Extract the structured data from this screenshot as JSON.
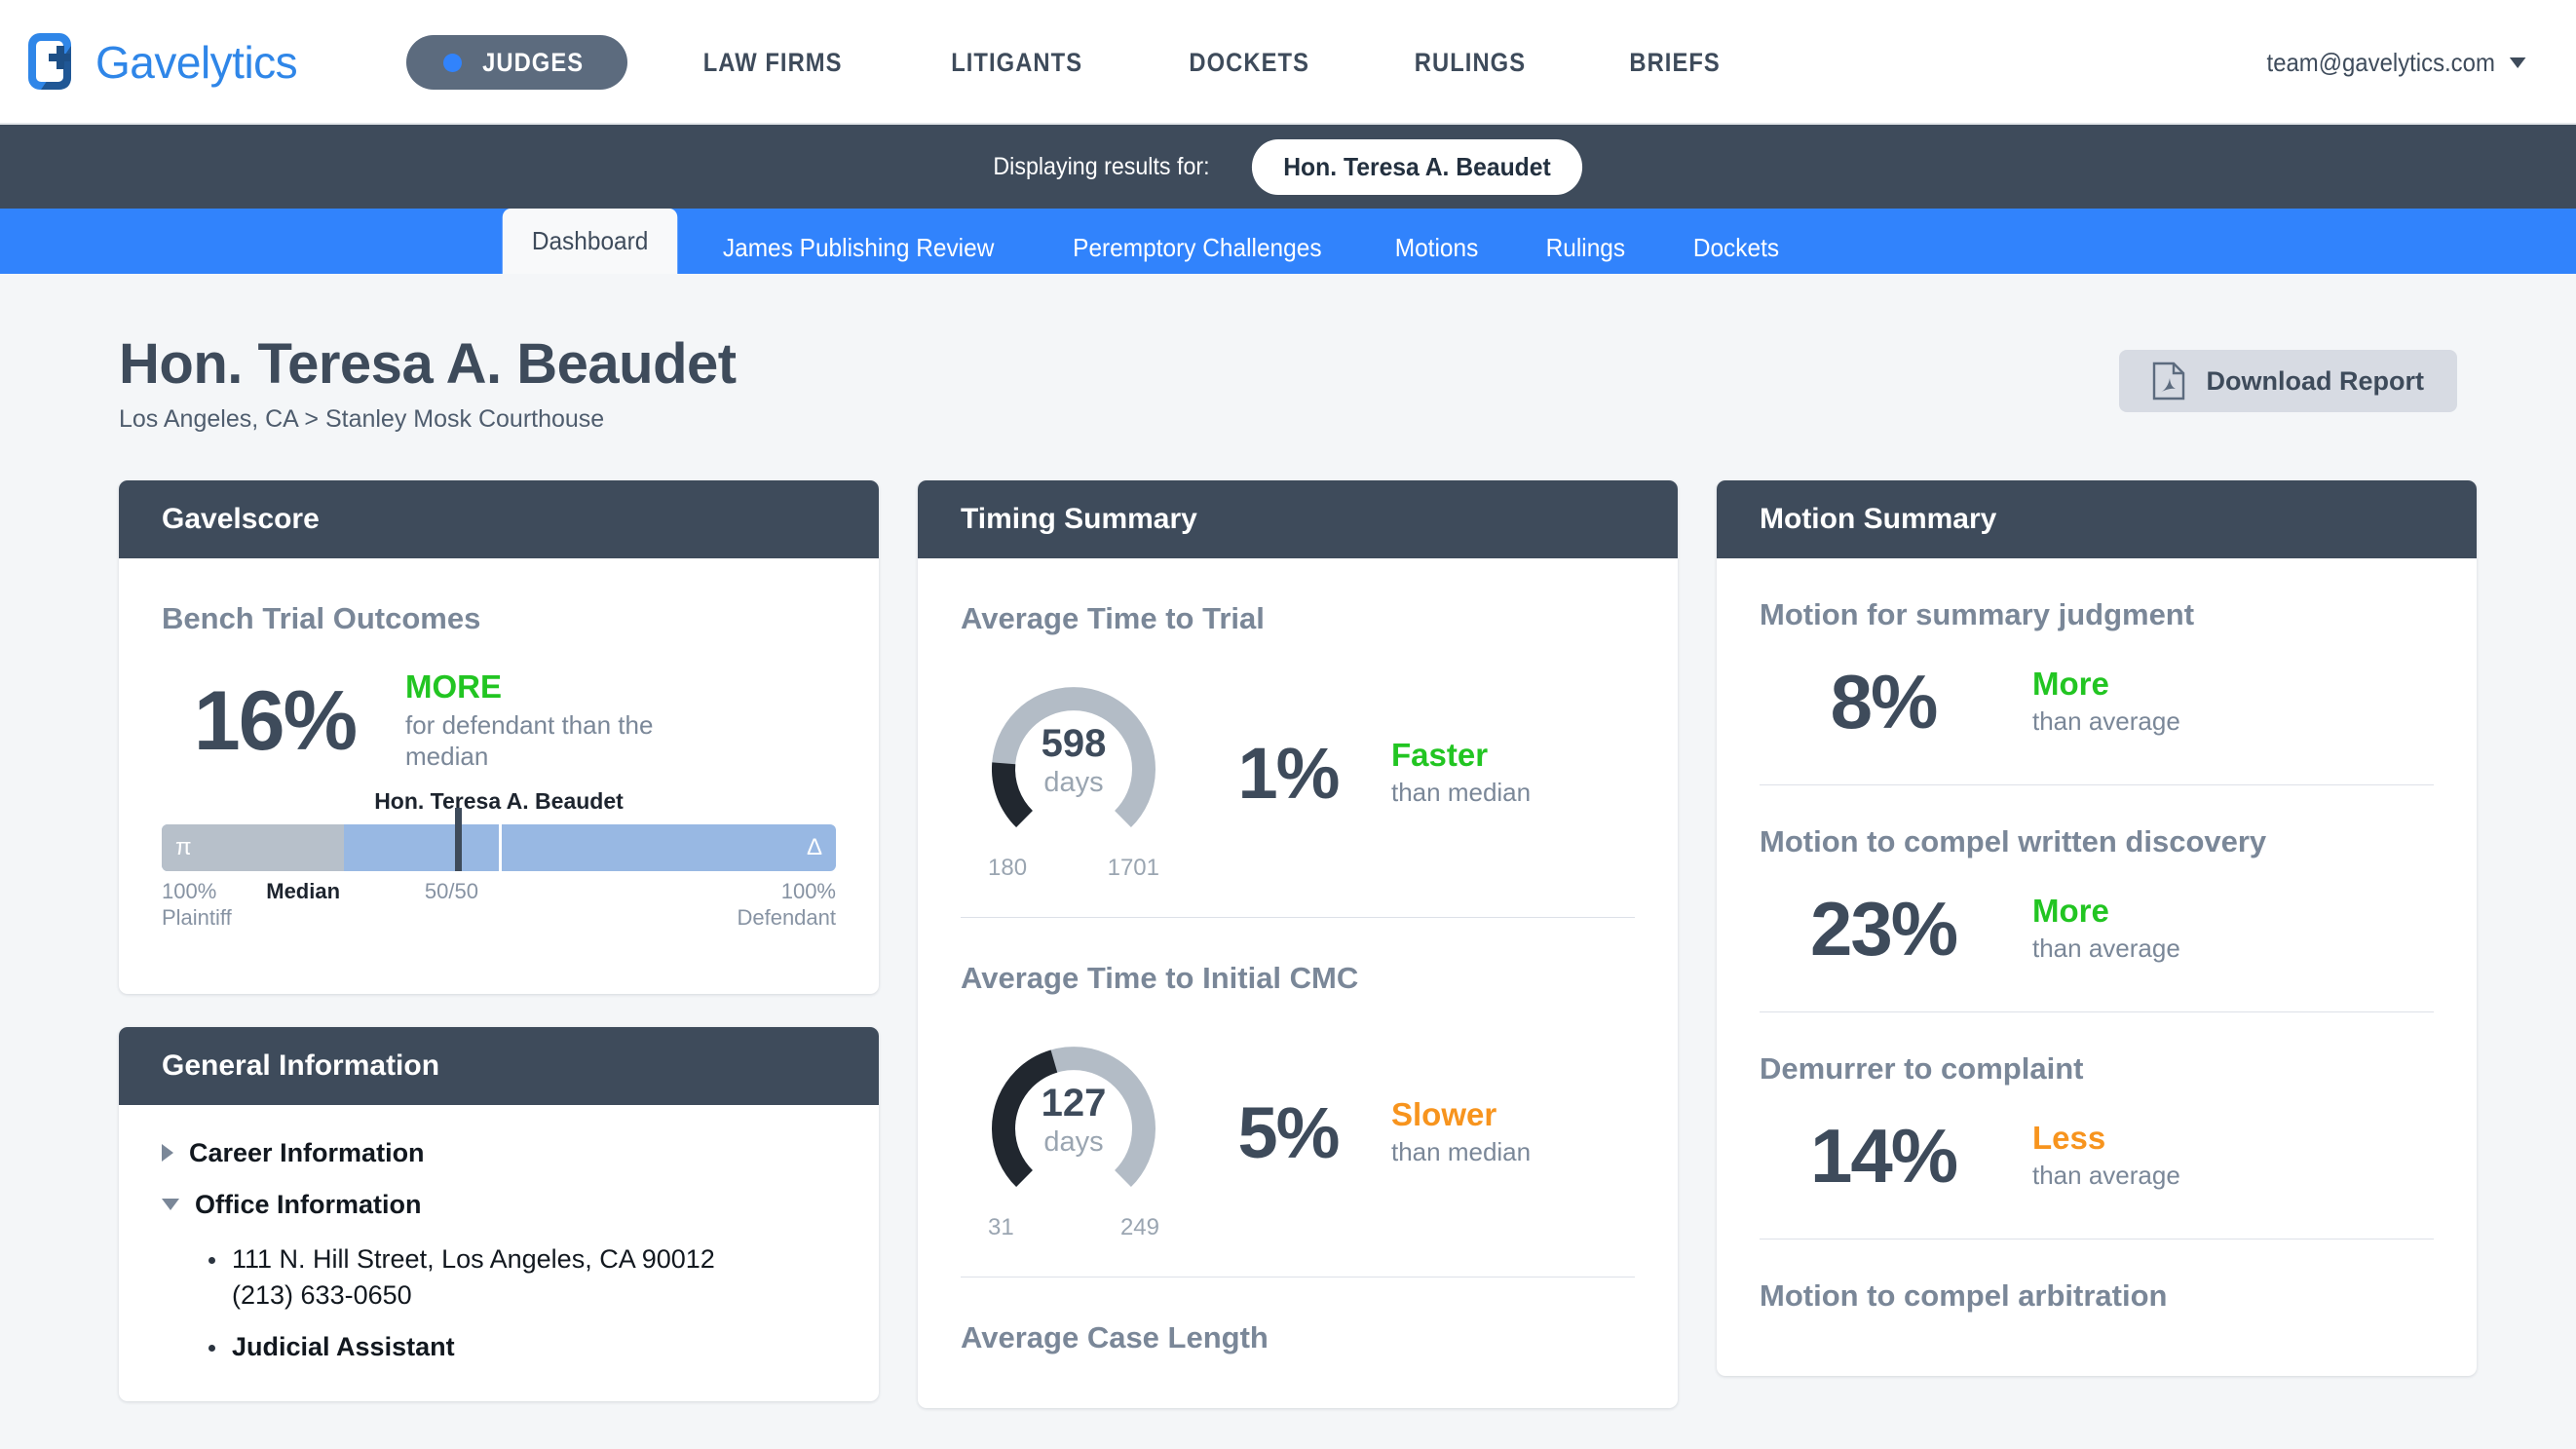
{
  "brand": {
    "name": "Gavelytics",
    "logo_icon": "gavelytics-logo-icon"
  },
  "topnav": {
    "items": [
      {
        "label": "JUDGES",
        "active": true
      },
      {
        "label": "LAW FIRMS",
        "active": false
      },
      {
        "label": "LITIGANTS",
        "active": false
      },
      {
        "label": "DOCKETS",
        "active": false
      },
      {
        "label": "RULINGS",
        "active": false
      },
      {
        "label": "BRIEFS",
        "active": false
      }
    ],
    "account_email": "team@gavelytics.com",
    "account_caret_icon": "chevron-down-icon"
  },
  "results_bar": {
    "label": "Displaying results for:",
    "chip": "Hon. Teresa A. Beaudet"
  },
  "tabs": [
    {
      "label": "Dashboard",
      "active": true
    },
    {
      "label": "James Publishing Review",
      "active": false
    },
    {
      "label": "Peremptory Challenges",
      "active": false
    },
    {
      "label": "Motions",
      "active": false
    },
    {
      "label": "Rulings",
      "active": false
    },
    {
      "label": "Dockets",
      "active": false
    }
  ],
  "page_head": {
    "title": "Hon. Teresa A. Beaudet",
    "subtitle": "Los Angeles, CA > Stanley Mosk Courthouse",
    "download_label": "Download Report",
    "download_icon": "pdf-file-icon"
  },
  "gavelscore": {
    "card_title": "Gavelscore",
    "metric_title": "Bench Trial Outcomes",
    "percent": "16%",
    "qualifier": "MORE",
    "qualifier_color": "#22c522",
    "qualifier_sub": "for defendant than the median",
    "slider": {
      "judge_name": "Hon. Teresa A. Beaudet",
      "plaintiff_symbol": "π",
      "defendant_symbol": "Δ",
      "label_left_top": "100%",
      "label_left_bottom": "Plaintiff",
      "label_median": "Median",
      "label_fifty": "50/50",
      "label_right_top": "100%",
      "label_right_bottom": "Defendant",
      "gray_segment_pct": 27,
      "marker_pct": 43.5,
      "divider_pct": 50
    }
  },
  "general_info": {
    "card_title": "General Information",
    "sections": [
      {
        "label": "Career Information",
        "expanded": false,
        "icon": "triangle-right-icon",
        "items": []
      },
      {
        "label": "Office Information",
        "expanded": true,
        "icon": "triangle-down-icon",
        "items": [
          "111 N. Hill Street, Los Angeles, CA 90012\n(213) 633-0650",
          "Judicial Assistant"
        ]
      }
    ]
  },
  "timing_summary": {
    "card_title": "Timing Summary",
    "metrics": [
      {
        "title": "Average Time to Trial",
        "value": "598",
        "unit": "days",
        "min": "180",
        "max": "1701",
        "percent": "1%",
        "qualifier": "Faster",
        "qualifier_class": "faster",
        "qualifier_sub": "than median",
        "fill_fraction": 0.185
      },
      {
        "title": "Average Time to Initial CMC",
        "value": "127",
        "unit": "days",
        "min": "31",
        "max": "249",
        "percent": "5%",
        "qualifier": "Slower",
        "qualifier_class": "slower",
        "qualifier_sub": "than median",
        "fill_fraction": 0.44
      },
      {
        "title": "Average Case Length",
        "value": "",
        "unit": "",
        "min": "",
        "max": "",
        "percent": "",
        "qualifier": "",
        "qualifier_class": "",
        "qualifier_sub": "",
        "fill_fraction": 0
      }
    ]
  },
  "motion_summary": {
    "card_title": "Motion Summary",
    "metrics": [
      {
        "title": "Motion for summary judgment",
        "percent": "8%",
        "qualifier": "More",
        "qualifier_class": "more",
        "qualifier_sub": "than average"
      },
      {
        "title": "Motion to compel written discovery",
        "percent": "23%",
        "qualifier": "More",
        "qualifier_class": "more",
        "qualifier_sub": "than average"
      },
      {
        "title": "Demurrer to complaint",
        "percent": "14%",
        "qualifier": "Less",
        "qualifier_class": "less",
        "qualifier_sub": "than average"
      },
      {
        "title": "Motion to compel arbitration",
        "percent": "",
        "qualifier": "",
        "qualifier_class": "",
        "qualifier_sub": ""
      }
    ]
  },
  "colors": {
    "dark": "#3e4b5b",
    "blue": "#3183fc",
    "green": "#22c522",
    "orange": "#f7941e",
    "gauge_track": "#b3bcc6",
    "gauge_fill": "#21272f",
    "slider_blue": "#98b8e3",
    "slider_gray": "#b7c0ca"
  }
}
